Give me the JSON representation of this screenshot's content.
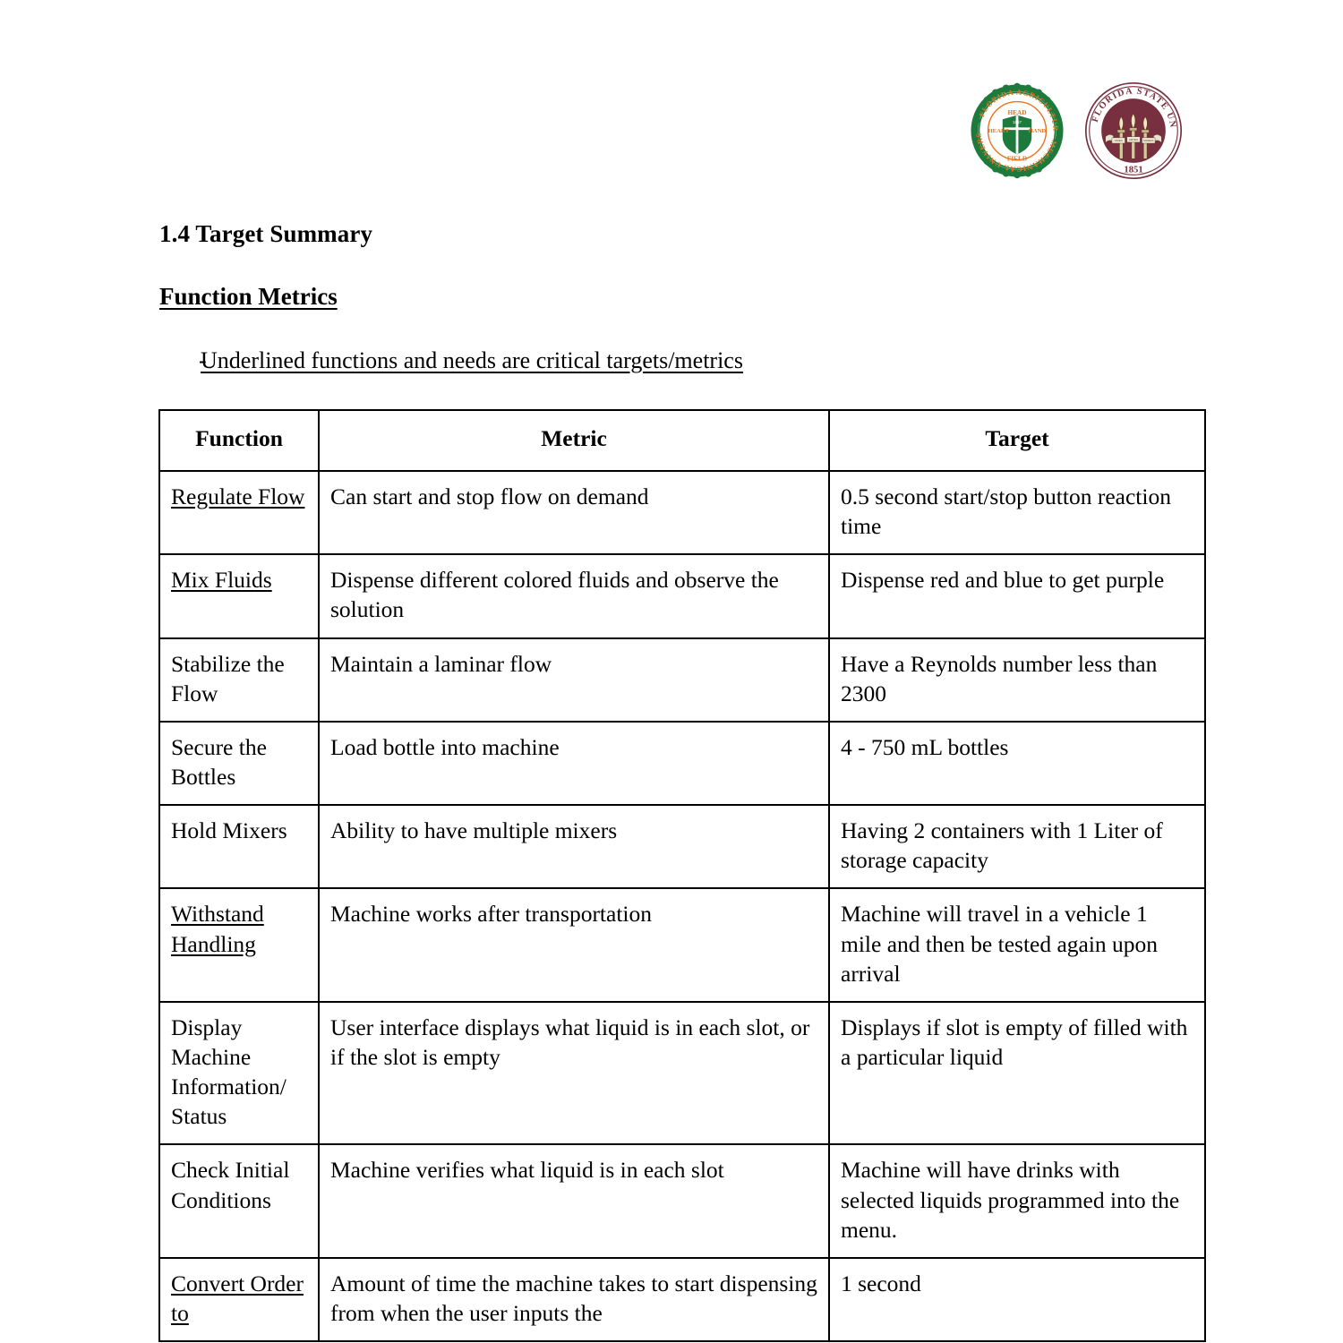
{
  "document": {
    "section_number_title": "1.4 Target Summary",
    "subsection_title": "Function Metrics",
    "bullet_mark": "-",
    "bullet_text": "Underlined functions and needs are critical targets/metrics"
  },
  "logos": {
    "famu": {
      "name": "famu-seal-icon",
      "ring_color": "#1e7a3c",
      "text_color": "#e8741c",
      "words_outer": "FLORIDA AGRICULTURAL MECHANICAL UNIVERSITY",
      "shield_words": [
        "HEAD",
        "HEART",
        "HAND",
        "FIELD"
      ],
      "shield_year": "1887"
    },
    "fsu": {
      "name": "fsu-seal-icon",
      "disc_color": "#782f40",
      "text_color": "#ffffff",
      "words_outer": "FLORIDA STATE UNIVERSITY",
      "year": "1851"
    }
  },
  "table": {
    "columns": [
      "Function",
      "Metric",
      "Target"
    ],
    "rows": [
      {
        "function": "Regulate Flow",
        "function_underlined": true,
        "metric": "Can start and stop flow on demand",
        "target": "0.5 second start/stop button reaction time",
        "clipped": false
      },
      {
        "function": "Mix Fluids",
        "function_underlined": true,
        "metric": "Dispense different colored fluids and observe the solution",
        "target": "Dispense red and blue to get purple",
        "clipped": false
      },
      {
        "function": "Stabilize the Flow",
        "function_underlined": false,
        "metric": "Maintain a laminar flow",
        "target": "Have a Reynolds number less than 2300",
        "clipped": false
      },
      {
        "function": "Secure the Bottles",
        "function_underlined": false,
        "metric": "Load bottle into machine",
        "target": "4 - 750 mL bottles",
        "clipped": false
      },
      {
        "function": "Hold Mixers",
        "function_underlined": false,
        "metric": "Ability to have multiple mixers",
        "target": "Having 2 containers with 1 Liter of storage capacity",
        "clipped": false
      },
      {
        "function": "Withstand Handling",
        "function_underlined": true,
        "metric": "Machine works after transportation",
        "target": "Machine will travel in a vehicle 1 mile and then be tested again upon arrival",
        "clipped": false
      },
      {
        "function": "Display Machine Information/ Status",
        "function_underlined": false,
        "metric": "User interface displays what liquid is in each slot, or if the slot is empty",
        "target": "Displays if slot is empty of filled with a particular liquid",
        "clipped": false
      },
      {
        "function": "Check Initial Conditions",
        "function_underlined": false,
        "metric": "Machine verifies what liquid is in each slot",
        "target": "Machine will have drinks with selected liquids programmed into the menu.",
        "clipped": false
      },
      {
        "function": "Convert Order to",
        "function_underlined": true,
        "metric": "Amount of time the machine takes to start dispensing from when the user inputs the",
        "target": "1 second",
        "clipped": true
      }
    ]
  }
}
